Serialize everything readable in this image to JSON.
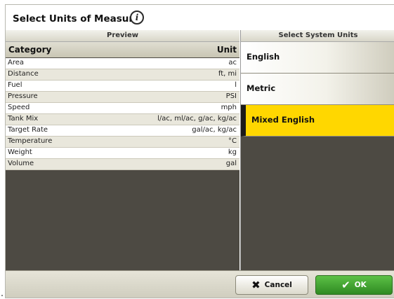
{
  "dialog": {
    "title": "Select Units of Measure",
    "info_icon": "i"
  },
  "preview": {
    "header": "Preview",
    "col_category": "Category",
    "col_unit": "Unit",
    "rows": [
      {
        "category": "Area",
        "unit": "ac"
      },
      {
        "category": "Distance",
        "unit": "ft, mi"
      },
      {
        "category": "Fuel",
        "unit": "l"
      },
      {
        "category": "Pressure",
        "unit": "PSI"
      },
      {
        "category": "Speed",
        "unit": "mph"
      },
      {
        "category": "Tank Mix",
        "unit": "l/ac, ml/ac, g/ac, kg/ac"
      },
      {
        "category": "Target Rate",
        "unit": "gal/ac, kg/ac"
      },
      {
        "category": "Temperature",
        "unit": "°C"
      },
      {
        "category": "Weight",
        "unit": "kg"
      },
      {
        "category": "Volume",
        "unit": "gal"
      }
    ]
  },
  "system_units": {
    "header": "Select System Units",
    "options": [
      "English",
      "Metric",
      "Mixed English"
    ],
    "selected": "Mixed English",
    "selected_color": "#ffd700"
  },
  "footer": {
    "cancel_label": "Cancel",
    "ok_label": "OK",
    "ok_color": "#3a9a2a"
  }
}
